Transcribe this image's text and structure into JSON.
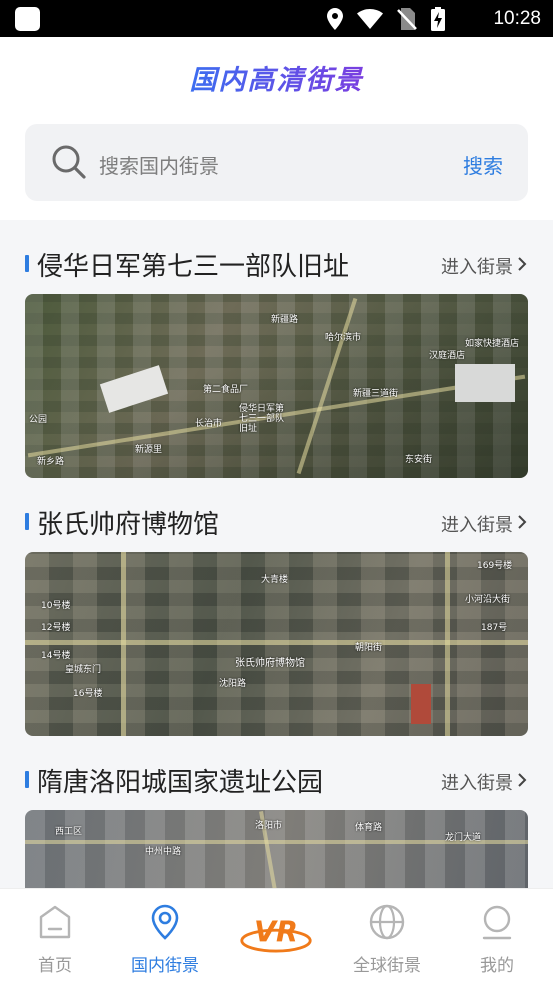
{
  "status_bar": {
    "time": "10:28",
    "icons": [
      "location-icon",
      "wifi-icon",
      "no-sim-icon",
      "battery-charging-icon"
    ]
  },
  "header": {
    "title": "国内高清街景"
  },
  "search": {
    "placeholder": "搜索国内街景",
    "button_label": "搜索"
  },
  "sections": [
    {
      "title": "侵华日军第七三一部队旧址",
      "enter_label": "进入街景",
      "map_labels": [
        "新疆路",
        "哈尔滨市",
        "第二食品厂",
        "长治市",
        "侵华日军第七三一部队旧址",
        "公园",
        "新疆三道街",
        "如家快捷酒店",
        "新源里",
        "东安街",
        "新乡路",
        "汉庭酒店"
      ]
    },
    {
      "title": "张氏帅府博物馆",
      "enter_label": "进入街景",
      "map_labels": [
        "张氏帅府博物馆",
        "大青楼",
        "10号楼",
        "12号楼",
        "14号楼",
        "16号楼",
        "朝阳街",
        "沈阳路",
        "皇城东门",
        "小河沿大街",
        "169号楼",
        "187号"
      ]
    },
    {
      "title": "隋唐洛阳城国家遗址公园",
      "enter_label": "进入街景",
      "map_labels": [
        "洛阳市",
        "体育路",
        "中州中路",
        "龙门大道",
        "西工区"
      ]
    }
  ],
  "bottom_nav": {
    "items": [
      {
        "label": "首页",
        "icon": "home-icon",
        "active": false
      },
      {
        "label": "国内街景",
        "icon": "location-pin-icon",
        "active": true
      },
      {
        "label": "VR",
        "icon": "vr-logo-icon",
        "active": false
      },
      {
        "label": "全球街景",
        "icon": "globe-icon",
        "active": false
      },
      {
        "label": "我的",
        "icon": "user-icon",
        "active": false
      }
    ]
  },
  "colors": {
    "accent": "#2e7de0",
    "title_gradient_start": "#3c6df0",
    "title_gradient_end": "#7a3ee0",
    "vr_orange": "#f07a1a"
  }
}
